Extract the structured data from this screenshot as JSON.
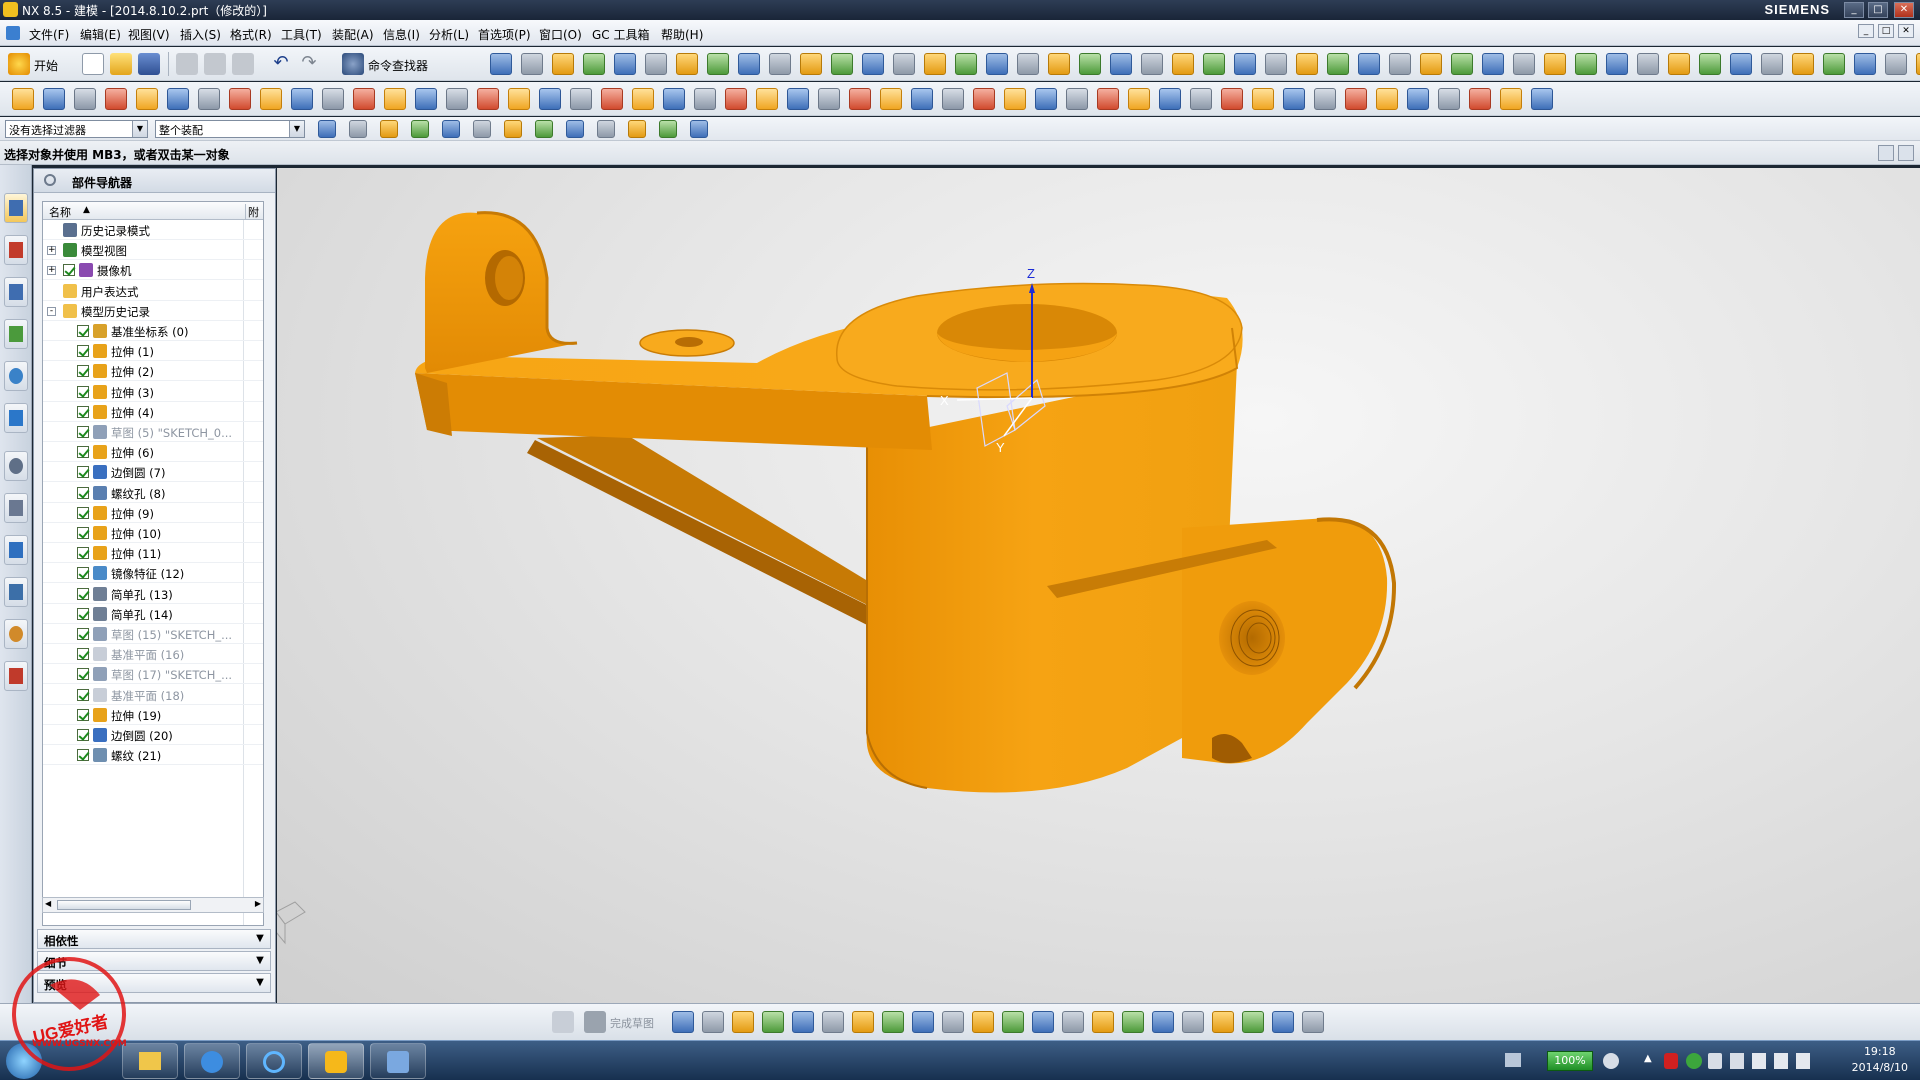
{
  "window": {
    "title": "NX 8.5 - 建模 - [2014.8.10.2.prt（修改的）]",
    "brand": "SIEMENS"
  },
  "menu": [
    "文件(F)",
    "编辑(E)",
    "视图(V)",
    "插入(S)",
    "格式(R)",
    "工具(T)",
    "装配(A)",
    "信息(I)",
    "分析(L)",
    "首选项(P)",
    "窗口(O)",
    "GC 工具箱",
    "帮助(H)"
  ],
  "toolbar": {
    "start_label": "开始",
    "command_finder_label": "命令查找器"
  },
  "filter": {
    "selection_filter": "没有选择过滤器",
    "assembly_scope": "整个装配"
  },
  "cue_line": "选择对象并使用 MB3，或者双击某一对象",
  "navigator": {
    "title": "部件导航器",
    "col_name": "名称",
    "col_attach": "附",
    "items": [
      {
        "label": "历史记录模式",
        "level": 0,
        "icon": "clock-icon"
      },
      {
        "label": "模型视图",
        "level": 0,
        "icon": "model-views-icon",
        "expand": "+"
      },
      {
        "label": "摄像机",
        "level": 0,
        "icon": "camera-icon",
        "expand": "+",
        "check": true
      },
      {
        "label": "用户表达式",
        "level": 0,
        "icon": "folder-icon"
      },
      {
        "label": "模型历史记录",
        "level": 0,
        "icon": "folder-open-icon",
        "expand": "-"
      },
      {
        "label": "基准坐标系 (0)",
        "level": 1,
        "icon": "datum-csys-icon",
        "check": true
      },
      {
        "label": "拉伸 (1)",
        "level": 1,
        "icon": "extrude-icon",
        "check": true
      },
      {
        "label": "拉伸 (2)",
        "level": 1,
        "icon": "extrude-icon",
        "check": true
      },
      {
        "label": "拉伸 (3)",
        "level": 1,
        "icon": "extrude-icon",
        "check": true
      },
      {
        "label": "拉伸 (4)",
        "level": 1,
        "icon": "extrude-icon",
        "check": true
      },
      {
        "label": "草图 (5) \"SKETCH_0...",
        "level": 1,
        "icon": "sketch-icon",
        "check": true,
        "dim": true
      },
      {
        "label": "拉伸 (6)",
        "level": 1,
        "icon": "extrude-icon",
        "check": true
      },
      {
        "label": "边倒圆 (7)",
        "level": 1,
        "icon": "edge-blend-icon",
        "check": true
      },
      {
        "label": "螺纹孔 (8)",
        "level": 1,
        "icon": "threaded-hole-icon",
        "check": true
      },
      {
        "label": "拉伸 (9)",
        "level": 1,
        "icon": "extrude-icon",
        "check": true
      },
      {
        "label": "拉伸 (10)",
        "level": 1,
        "icon": "extrude-icon",
        "check": true
      },
      {
        "label": "拉伸 (11)",
        "level": 1,
        "icon": "extrude-icon",
        "check": true
      },
      {
        "label": "镜像特征 (12)",
        "level": 1,
        "icon": "mirror-icon",
        "check": true
      },
      {
        "label": "简单孔 (13)",
        "level": 1,
        "icon": "hole-icon",
        "check": true
      },
      {
        "label": "简单孔 (14)",
        "level": 1,
        "icon": "hole-icon",
        "check": true
      },
      {
        "label": "草图 (15) \"SKETCH_...",
        "level": 1,
        "icon": "sketch-icon",
        "check": true,
        "dim": true
      },
      {
        "label": "基准平面 (16)",
        "level": 1,
        "icon": "datum-plane-icon",
        "check": true,
        "dim": true
      },
      {
        "label": "草图 (17) \"SKETCH_...",
        "level": 1,
        "icon": "sketch-icon",
        "check": true,
        "dim": true
      },
      {
        "label": "基准平面 (18)",
        "level": 1,
        "icon": "datum-plane-icon",
        "check": true,
        "dim": true
      },
      {
        "label": "拉伸 (19)",
        "level": 1,
        "icon": "extrude-icon",
        "check": true
      },
      {
        "label": "边倒圆 (20)",
        "level": 1,
        "icon": "edge-blend-icon",
        "check": true
      },
      {
        "label": "螺纹 (21)",
        "level": 1,
        "icon": "thread-icon",
        "check": true
      }
    ],
    "sections": [
      "相依性",
      "细节",
      "预览"
    ]
  },
  "sketch_toolbar": {
    "finish_sketch": "完成草图"
  },
  "axes": {
    "x": "X",
    "y": "Y",
    "z": "Z"
  },
  "watermark": {
    "text": "UG爱好者",
    "url": "WWW.UGSNX.COM"
  },
  "taskbar": {
    "battery": "100%",
    "time": "19:18",
    "date": "2014/8/10"
  },
  "colors": {
    "part": "#f5a00f",
    "part_dark": "#c47a06",
    "part_light": "#ffc24a"
  }
}
